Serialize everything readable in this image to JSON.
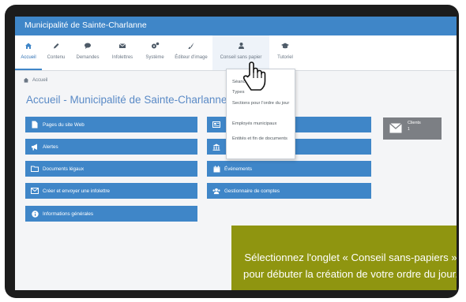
{
  "app": {
    "title": "Municipalité de Sainte-Charlanne"
  },
  "tabs": [
    {
      "label": "Accueil",
      "icon": "home-icon"
    },
    {
      "label": "Contenu",
      "icon": "pencil-icon"
    },
    {
      "label": "Demandes",
      "icon": "comment-icon"
    },
    {
      "label": "Infolettres",
      "icon": "envelope-icon"
    },
    {
      "label": "Système",
      "icon": "gears-icon"
    },
    {
      "label": "Éditeur d'image",
      "icon": "brush-icon"
    },
    {
      "label": "Conseil sans papier",
      "icon": "group-icon"
    },
    {
      "label": "Tutoriel",
      "icon": "graduation-cap-icon"
    }
  ],
  "breadcrumb": {
    "label": "Accueil"
  },
  "page": {
    "title": "Accueil - Municipalité de Sainte-Charlanne"
  },
  "shortcuts": {
    "left": [
      {
        "label": "Pages du site Web",
        "icon": "file-icon"
      },
      {
        "label": "Alertes",
        "icon": "bullhorn-icon"
      },
      {
        "label": "Documents légaux",
        "icon": "folder-icon"
      },
      {
        "label": "Créer et envoyer une infolettre",
        "icon": "envelope-icon"
      },
      {
        "label": "Informations générales",
        "icon": "info-icon"
      }
    ],
    "right": [
      {
        "label": "",
        "icon": "newspaper-icon"
      },
      {
        "label": "",
        "icon": "bank-icon"
      },
      {
        "label": "Événements",
        "icon": "calendar-icon"
      },
      {
        "label": "Gestionnaire de comptes",
        "icon": "users-icon"
      }
    ]
  },
  "stat_tile": {
    "label": "Clients",
    "value": "1",
    "icon": "envelope-icon"
  },
  "dropdown": {
    "items": [
      "Séances",
      "Types",
      "Sections pour l'ordre du jour",
      "Employés municipaux",
      "Entités et fin de documents"
    ]
  },
  "callout": {
    "text": "Sélectionnez l'onglet « Conseil sans-papiers » pour débuter la création de votre ordre du jour."
  },
  "colors": {
    "primary": "#3f86c8",
    "titlebar": "#3f86c8",
    "callout": "#8f9510",
    "frame": "#1c1c1c",
    "tile": "#7c7f84"
  }
}
